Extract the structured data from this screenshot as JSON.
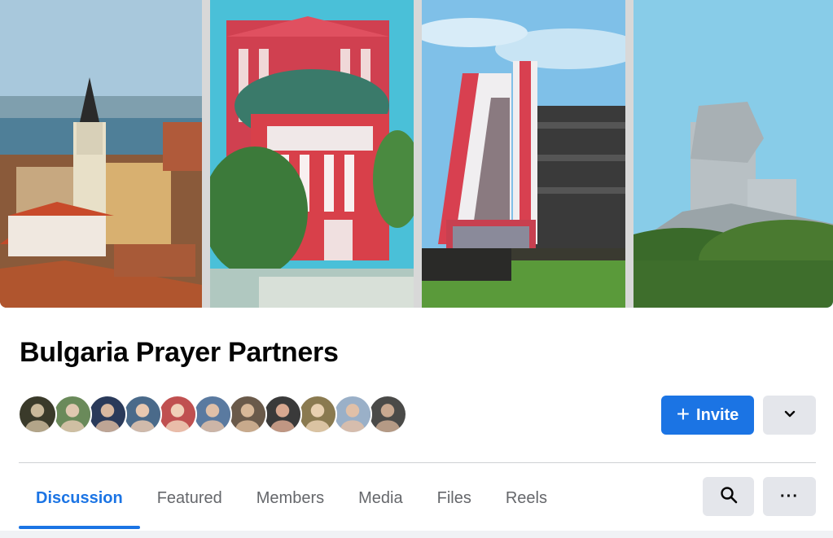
{
  "group": {
    "name": "Bulgaria Prayer Partners",
    "cover_photos": [
      "church-city-view",
      "opera-house",
      "modern-tower",
      "monument-hill"
    ],
    "member_avatars": [
      {
        "bg": "#3a3a2a",
        "fg": "#c9b89a"
      },
      {
        "bg": "#6a8a5a",
        "fg": "#e0c8b0"
      },
      {
        "bg": "#2a3a5a",
        "fg": "#d8b8a0"
      },
      {
        "bg": "#4a6a8a",
        "fg": "#e8c8b0"
      },
      {
        "bg": "#c05050",
        "fg": "#f0d0b8"
      },
      {
        "bg": "#5a7aa0",
        "fg": "#e0c0a8"
      },
      {
        "bg": "#6a5a4a",
        "fg": "#d8b898"
      },
      {
        "bg": "#3a3a3a",
        "fg": "#d8a890"
      },
      {
        "bg": "#8a7a50",
        "fg": "#e8d0b0"
      },
      {
        "bg": "#9ab0c8",
        "fg": "#e0c0a8"
      },
      {
        "bg": "#4a4a48",
        "fg": "#c8a890"
      }
    ]
  },
  "actions": {
    "invite_label": "Invite",
    "invite_icon": "plus-icon",
    "dropdown_icon": "chevron-down-icon"
  },
  "tabs": [
    {
      "label": "Discussion",
      "active": true
    },
    {
      "label": "Featured",
      "active": false
    },
    {
      "label": "Members",
      "active": false
    },
    {
      "label": "Media",
      "active": false
    },
    {
      "label": "Files",
      "active": false
    },
    {
      "label": "Reels",
      "active": false
    }
  ],
  "toolbar": {
    "search_icon": "search-icon",
    "more_label": "···"
  },
  "colors": {
    "accent": "#1b74e4",
    "secondary_button": "#e4e6eb",
    "muted_text": "#65676b"
  }
}
